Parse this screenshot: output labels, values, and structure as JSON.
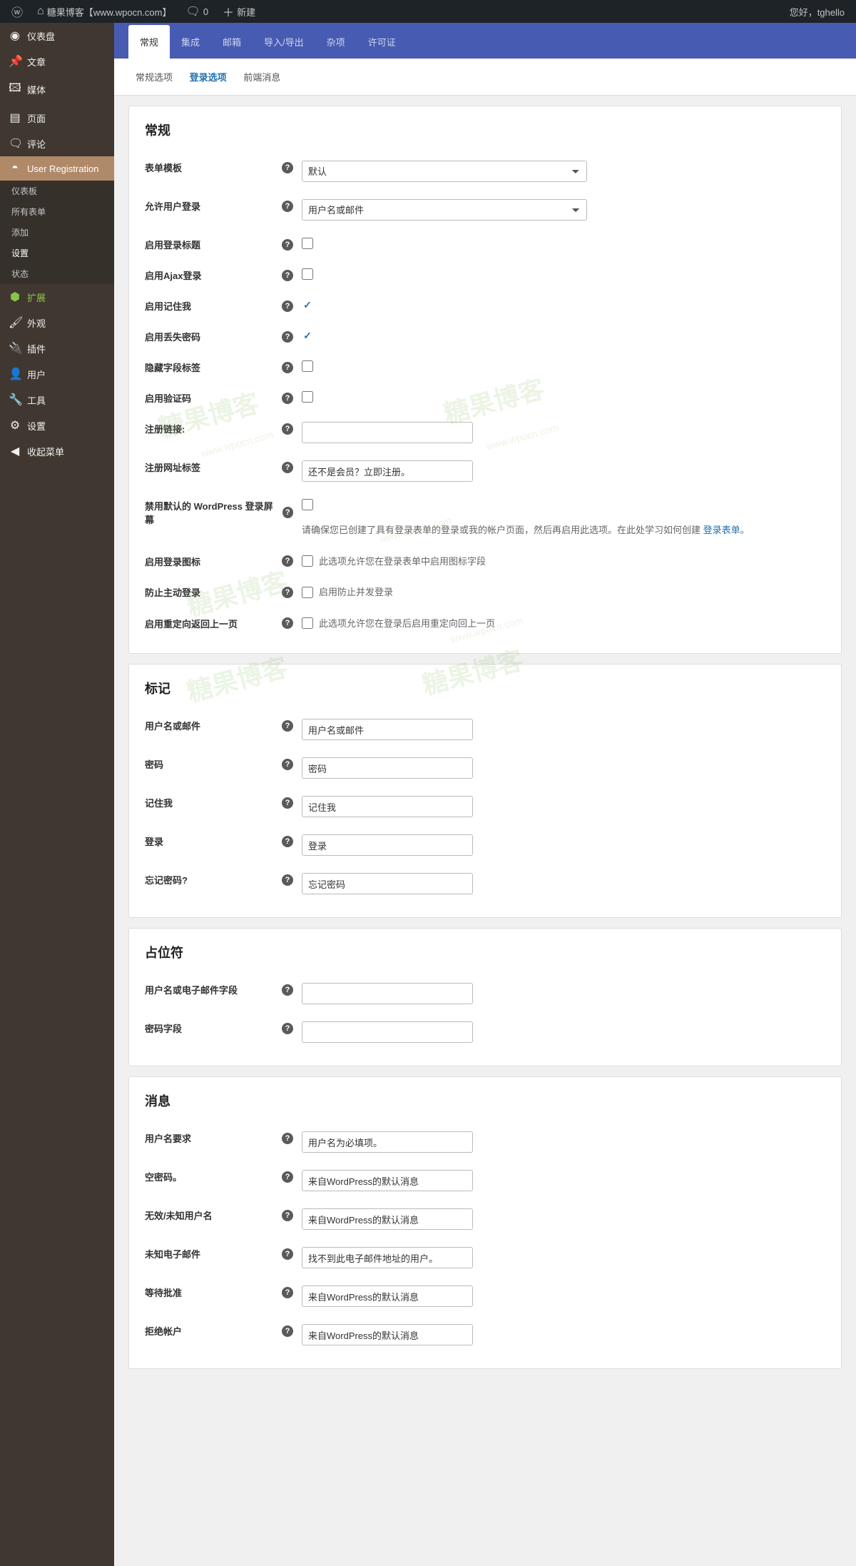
{
  "adminbar": {
    "site_name": "糖果博客【www.wpocn.com】",
    "comments": "0",
    "new": "新建",
    "greeting": "您好，tghello"
  },
  "sidebar": {
    "dashboard": "仪表盘",
    "posts": "文章",
    "media": "媒体",
    "pages": "页面",
    "comments": "评论",
    "ur": "User Registration",
    "ur_sub": {
      "dashboard": "仪表板",
      "all_forms": "所有表单",
      "add": "添加",
      "settings": "设置",
      "status": "状态"
    },
    "extensions": "扩展",
    "appearance": "外观",
    "plugins": "插件",
    "users": "用户",
    "tools": "工具",
    "settings": "设置",
    "collapse": "收起菜单"
  },
  "top_tabs": {
    "general": "常规",
    "integration": "集成",
    "email": "邮箱",
    "import_export": "导入/导出",
    "misc": "杂项",
    "license": "许可证"
  },
  "sub_tabs": {
    "general_options": "常规选项",
    "login_options": "登录选项",
    "frontend_messages": "前端消息"
  },
  "panels": {
    "general": {
      "title": "常规",
      "form_template": {
        "label": "表单模板",
        "value": "默认"
      },
      "allow_login": {
        "label": "允许用户登录",
        "value": "用户名或邮件"
      },
      "enable_login_title": {
        "label": "启用登录标题"
      },
      "enable_ajax": {
        "label": "启用Ajax登录"
      },
      "enable_remember": {
        "label": "启用记住我"
      },
      "enable_lost_pw": {
        "label": "启用丢失密码"
      },
      "hide_field_labels": {
        "label": "隐藏字段标签"
      },
      "enable_captcha": {
        "label": "启用验证码"
      },
      "register_link": {
        "label": "注册链接:"
      },
      "register_url_label": {
        "label": "注册网址标签",
        "value": "还不是会员？立即注册。"
      },
      "disable_wp_login": {
        "label": "禁用默认的 WordPress 登录屏幕",
        "desc_a": "请确保您已创建了具有登录表单的登录或我的帐户页面，然后再启用此选项。在此处学习如何创建 ",
        "desc_link": "登录表单",
        "desc_b": "。"
      },
      "enable_login_icons": {
        "label": "启用登录图标",
        "desc": "此选项允许您在登录表单中启用图标字段"
      },
      "prevent_active_login": {
        "label": "防止主动登录",
        "desc": "启用防止并发登录"
      },
      "enable_redirect_back": {
        "label": "启用重定向返回上一页",
        "desc": "此选项允许您在登录后启用重定向回上一页"
      }
    },
    "labels": {
      "title": "标记",
      "username": {
        "label": "用户名或邮件",
        "value": "用户名或邮件"
      },
      "password": {
        "label": "密码",
        "value": "密码"
      },
      "remember": {
        "label": "记住我",
        "value": "记住我"
      },
      "login": {
        "label": "登录",
        "value": "登录"
      },
      "forgot": {
        "label": "忘记密码?",
        "value": "忘记密码"
      }
    },
    "placeholders": {
      "title": "占位符",
      "username_field": "用户名或电子邮件字段",
      "password_field": "密码字段"
    },
    "messages": {
      "title": "消息",
      "username_req": {
        "label": "用户名要求",
        "value": "用户名为必填项。"
      },
      "empty_pw": {
        "label": "空密码。",
        "value": "来自WordPress的默认消息"
      },
      "invalid_user": {
        "label": "无效/未知用户名",
        "value": "来自WordPress的默认消息"
      },
      "unknown_email": {
        "label": "未知电子邮件",
        "value": "找不到此电子邮件地址的用户。"
      },
      "pending": {
        "label": "等待批准",
        "value": "来自WordPress的默认消息"
      },
      "denied": {
        "label": "拒绝帐户",
        "value": "来自WordPress的默认消息"
      }
    }
  },
  "watermark": "糖果博客",
  "watermark_url": "www.wpocn.com"
}
